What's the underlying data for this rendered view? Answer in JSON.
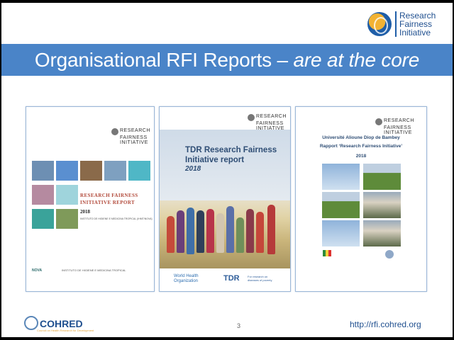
{
  "header": {
    "logo_lines": [
      "Research",
      "Fairness",
      "Initiative"
    ],
    "title_main": "Organisational RFI Reports –",
    "title_italic": "are at the core"
  },
  "reports": [
    {
      "logo_lines": [
        "RESEARCH",
        "FAIRNESS",
        "INITIATIVE"
      ],
      "title_lines": [
        "RESEARCH FAIRNESS",
        "INITIATIVE REPORT"
      ],
      "year": "2018",
      "institution": "INSTITUTO DE HIGIENE E MEDICINA TROPICAL (IHMT/NOVA)",
      "footer_left": "NOVA",
      "footer_right": "INSTITUTO DE HIGIENE E MEDICINA TROPICAL"
    },
    {
      "logo_lines": [
        "RESEARCH",
        "FAIRNESS",
        "INITIATIVE"
      ],
      "title_lines": [
        "TDR Research Fairness",
        "Initiative report"
      ],
      "year": "2018",
      "who_lines": [
        "World Health",
        "Organization"
      ],
      "tdr": "TDR",
      "tdr_sub": [
        "For research on",
        "diseases of poverty"
      ]
    },
    {
      "logo_lines": [
        "RESEARCH",
        "FAIRNESS",
        "INITIATIVE"
      ],
      "university": "Université Alioune Diop de Bambey",
      "report_title": "Rapport ‘Research Fairness Initiative’",
      "year": "2018"
    }
  ],
  "footer": {
    "org": "COHRED",
    "org_sub": "Council on Health Research for Development",
    "page_number": "3",
    "url": "http://rfi.cohred.org"
  }
}
